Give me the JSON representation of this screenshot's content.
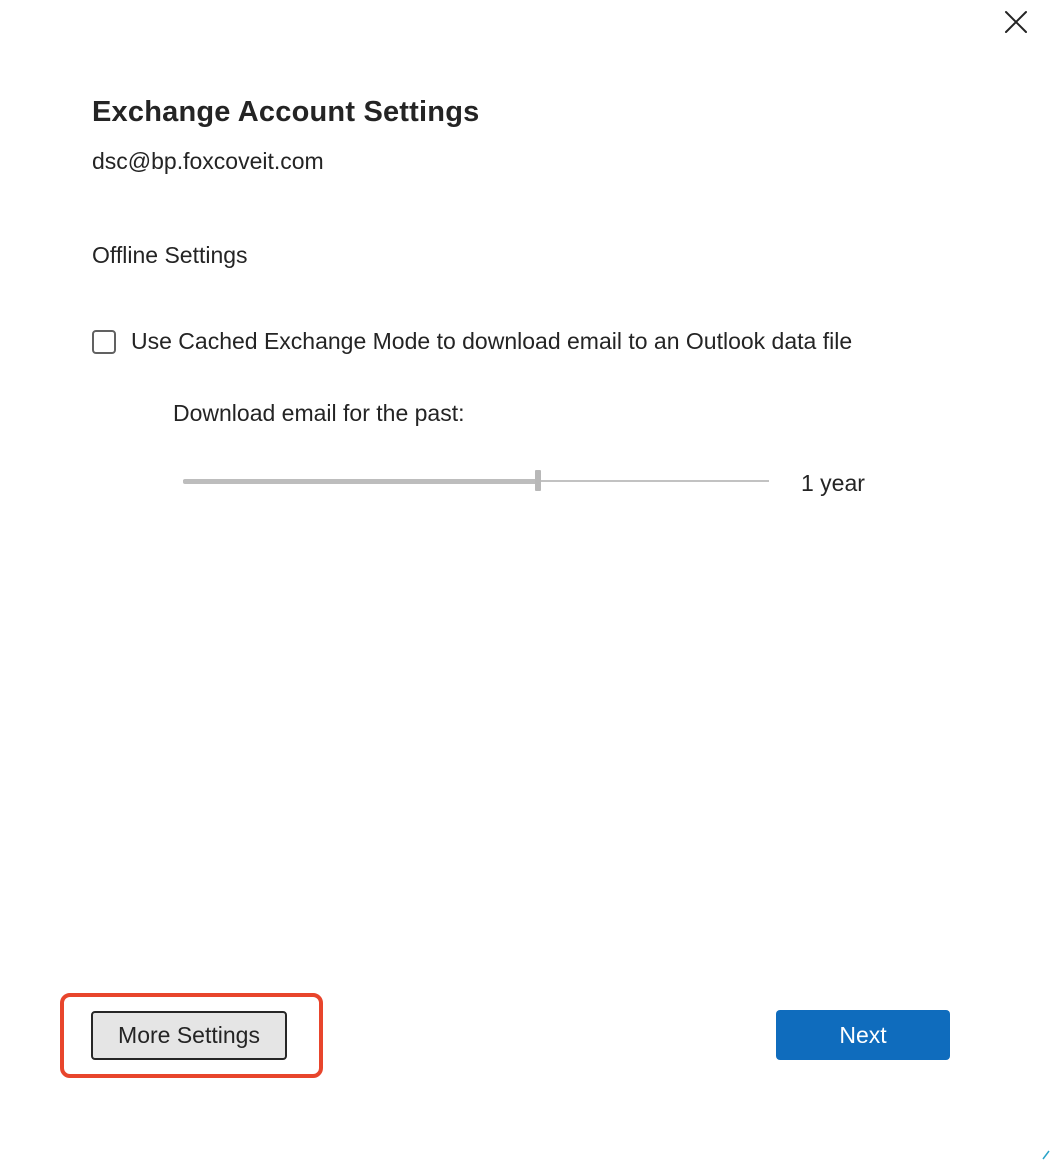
{
  "dialog": {
    "title": "Exchange Account Settings",
    "account_email": "dsc@bp.foxcoveit.com",
    "close_icon": "close-icon"
  },
  "offline": {
    "heading": "Offline Settings",
    "cached_mode": {
      "label": "Use Cached Exchange Mode to download email to an Outlook data file",
      "checked": false
    },
    "download": {
      "label": "Download email for the past:",
      "value_label": "1 year",
      "slider_fraction": 0.605
    }
  },
  "footer": {
    "more_settings_label": "More Settings",
    "next_label": "Next"
  },
  "colors": {
    "accent": "#0f6cbd",
    "highlight": "#e8452c",
    "text": "#242424",
    "slider": "#c2c2c2"
  }
}
